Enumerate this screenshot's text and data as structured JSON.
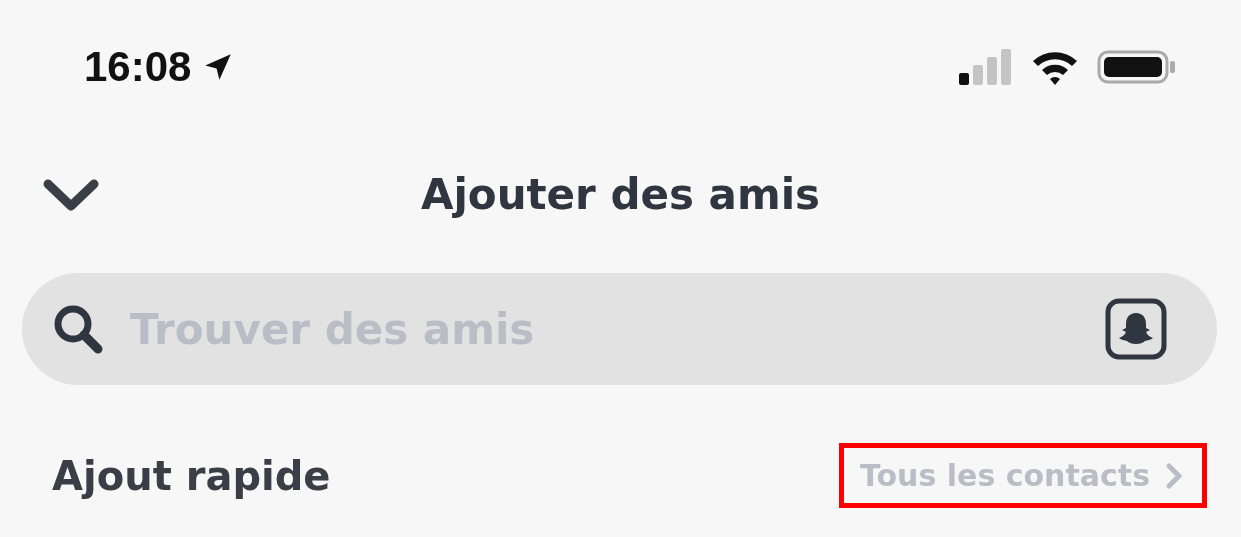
{
  "status_bar": {
    "time": "16:08"
  },
  "header": {
    "title": "Ajouter des amis"
  },
  "search": {
    "placeholder": "Trouver des amis"
  },
  "quick_add": {
    "title": "Ajout rapide",
    "link": {
      "label": "Tous les contacts",
      "highlighted": true
    }
  }
}
